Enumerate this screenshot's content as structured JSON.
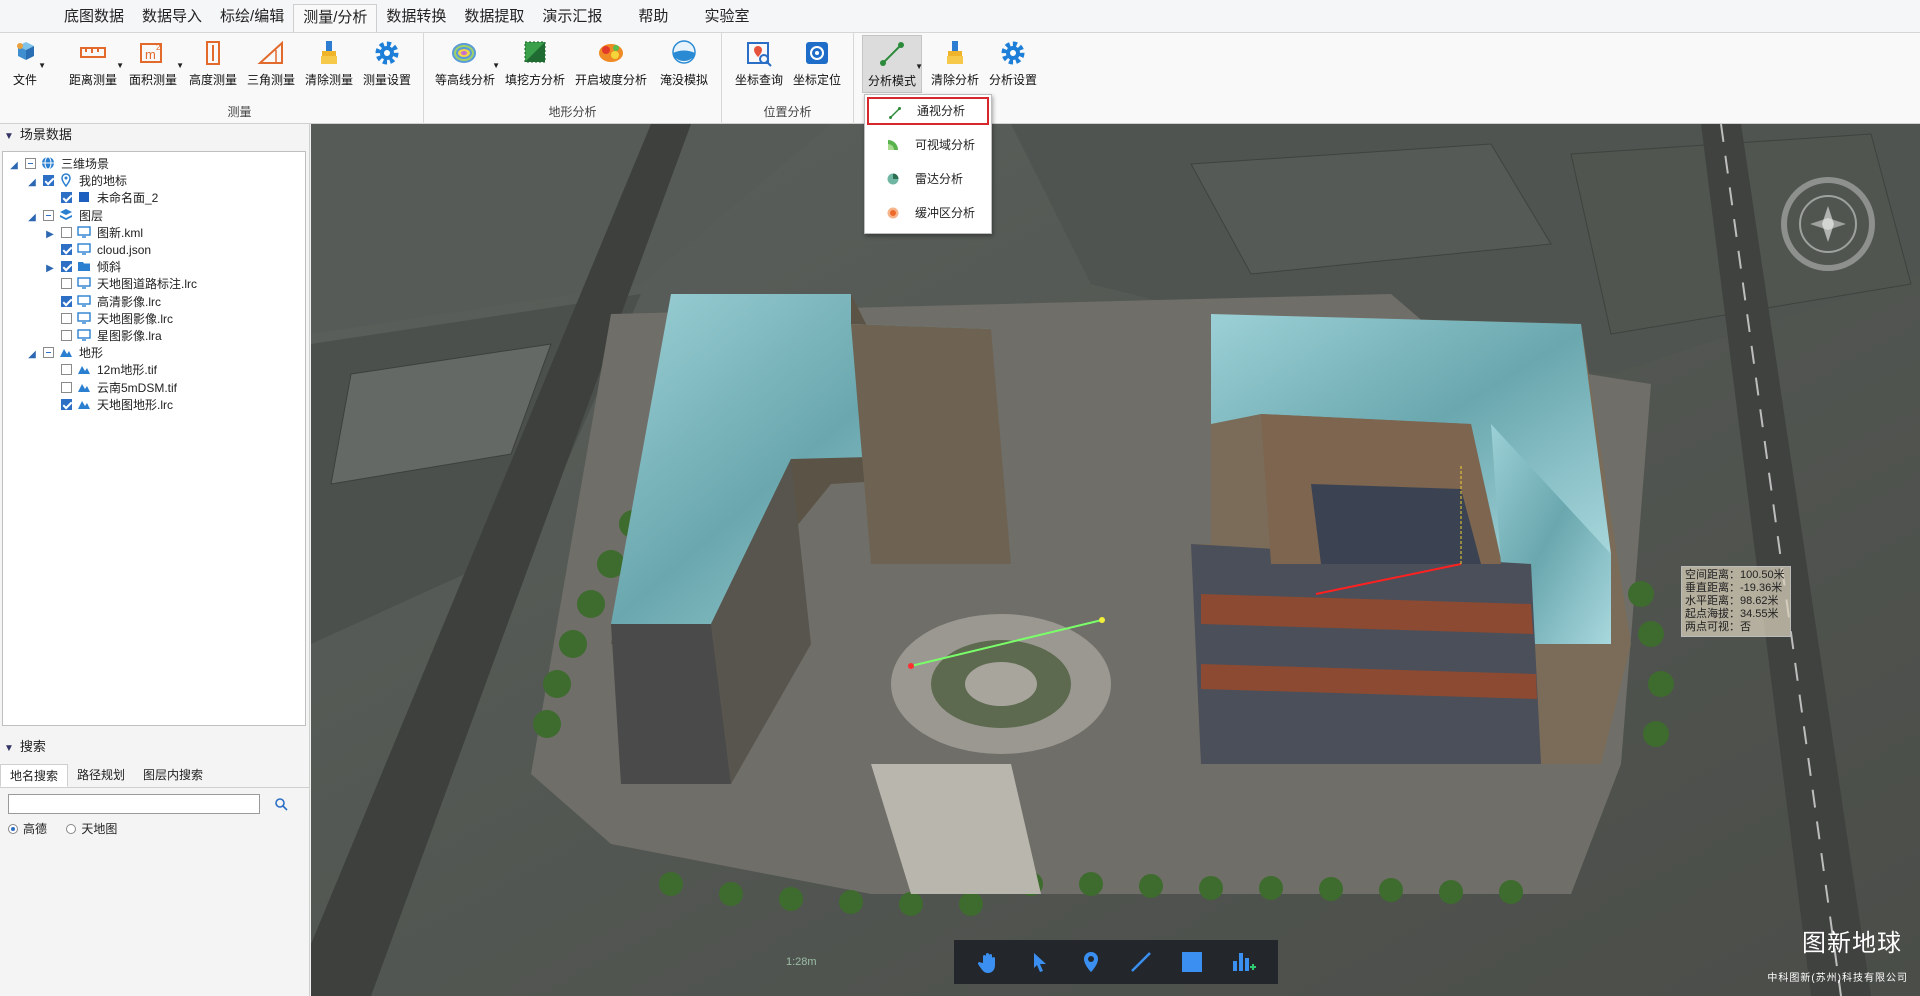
{
  "menu": {
    "tabs": [
      "底图数据",
      "数据导入",
      "标绘/编辑",
      "测量/分析",
      "数据转换",
      "数据提取",
      "演示汇报",
      "帮助",
      "实验室"
    ],
    "active_index": 3
  },
  "ribbon": {
    "file_label": "文件",
    "measure_group": {
      "label": "测量",
      "buttons": [
        "距离测量",
        "面积测量",
        "高度测量",
        "三角测量",
        "清除测量",
        "测量设置"
      ]
    },
    "terrain_group": {
      "label": "地形分析",
      "buttons": [
        "等高线分析",
        "填挖方分析",
        "开启坡度分析",
        "淹没模拟"
      ]
    },
    "position_group": {
      "label": "位置分析",
      "buttons": [
        "坐标查询",
        "坐标定位"
      ]
    },
    "analysis_group": {
      "buttons": [
        "分析模式",
        "清除分析",
        "分析设置"
      ]
    }
  },
  "analysis_dropdown": {
    "items": [
      "通视分析",
      "可视域分析",
      "雷达分析",
      "缓冲区分析"
    ],
    "highlighted_index": 0
  },
  "scene_panel": {
    "title": "场景数据",
    "tree": [
      {
        "label": "三维场景",
        "level": 0,
        "expanded": true,
        "check": "partial",
        "icon": "globe-icon"
      },
      {
        "label": "我的地标",
        "level": 1,
        "expanded": true,
        "check": "on",
        "icon": "pin-icon"
      },
      {
        "label": "未命名面_2",
        "level": 2,
        "check": "on",
        "icon": "polygon-icon"
      },
      {
        "label": "图层",
        "level": 1,
        "expanded": true,
        "check": "partial",
        "icon": "layers-icon"
      },
      {
        "label": "图新.kml",
        "level": 2,
        "collapsed": true,
        "check": "off",
        "icon": "monitor-icon"
      },
      {
        "label": "cloud.json",
        "level": 2,
        "check": "on",
        "icon": "monitor-icon"
      },
      {
        "label": "倾斜",
        "level": 2,
        "collapsed": true,
        "check": "on",
        "icon": "folder-icon"
      },
      {
        "label": "天地图道路标注.lrc",
        "level": 2,
        "check": "off",
        "icon": "monitor-icon"
      },
      {
        "label": "高清影像.lrc",
        "level": 2,
        "check": "on",
        "icon": "monitor-icon"
      },
      {
        "label": "天地图影像.lrc",
        "level": 2,
        "check": "off",
        "icon": "monitor-icon"
      },
      {
        "label": "星图影像.lra",
        "level": 2,
        "check": "off",
        "icon": "monitor-icon"
      },
      {
        "label": "地形",
        "level": 1,
        "expanded": true,
        "check": "partial",
        "icon": "terrain-icon"
      },
      {
        "label": "12m地形.tif",
        "level": 2,
        "check": "off",
        "icon": "terrain-icon"
      },
      {
        "label": "云南5mDSM.tif",
        "level": 2,
        "check": "off",
        "icon": "terrain-icon"
      },
      {
        "label": "天地图地形.lrc",
        "level": 2,
        "check": "on",
        "icon": "terrain-icon"
      }
    ]
  },
  "search_panel": {
    "title": "搜索",
    "tabs": [
      "地名搜索",
      "路径规划",
      "图层内搜索"
    ],
    "input_value": "",
    "sources": [
      "高德",
      "天地图"
    ],
    "selected_source": "高德"
  },
  "map": {
    "measurement": [
      "空间距离：100.50米",
      "垂直距离：-19.36米",
      "水平距离：98.62米",
      "起点海拔：34.55米",
      "两点可视：否"
    ],
    "scale_text": "1:28m",
    "toolbar": [
      "hand-icon",
      "pointer-icon",
      "pin-icon",
      "line-icon",
      "square-icon",
      "chart-add-icon"
    ],
    "brand": "图新地球",
    "brand_sub": "中科图新(苏州)科技有限公司"
  }
}
